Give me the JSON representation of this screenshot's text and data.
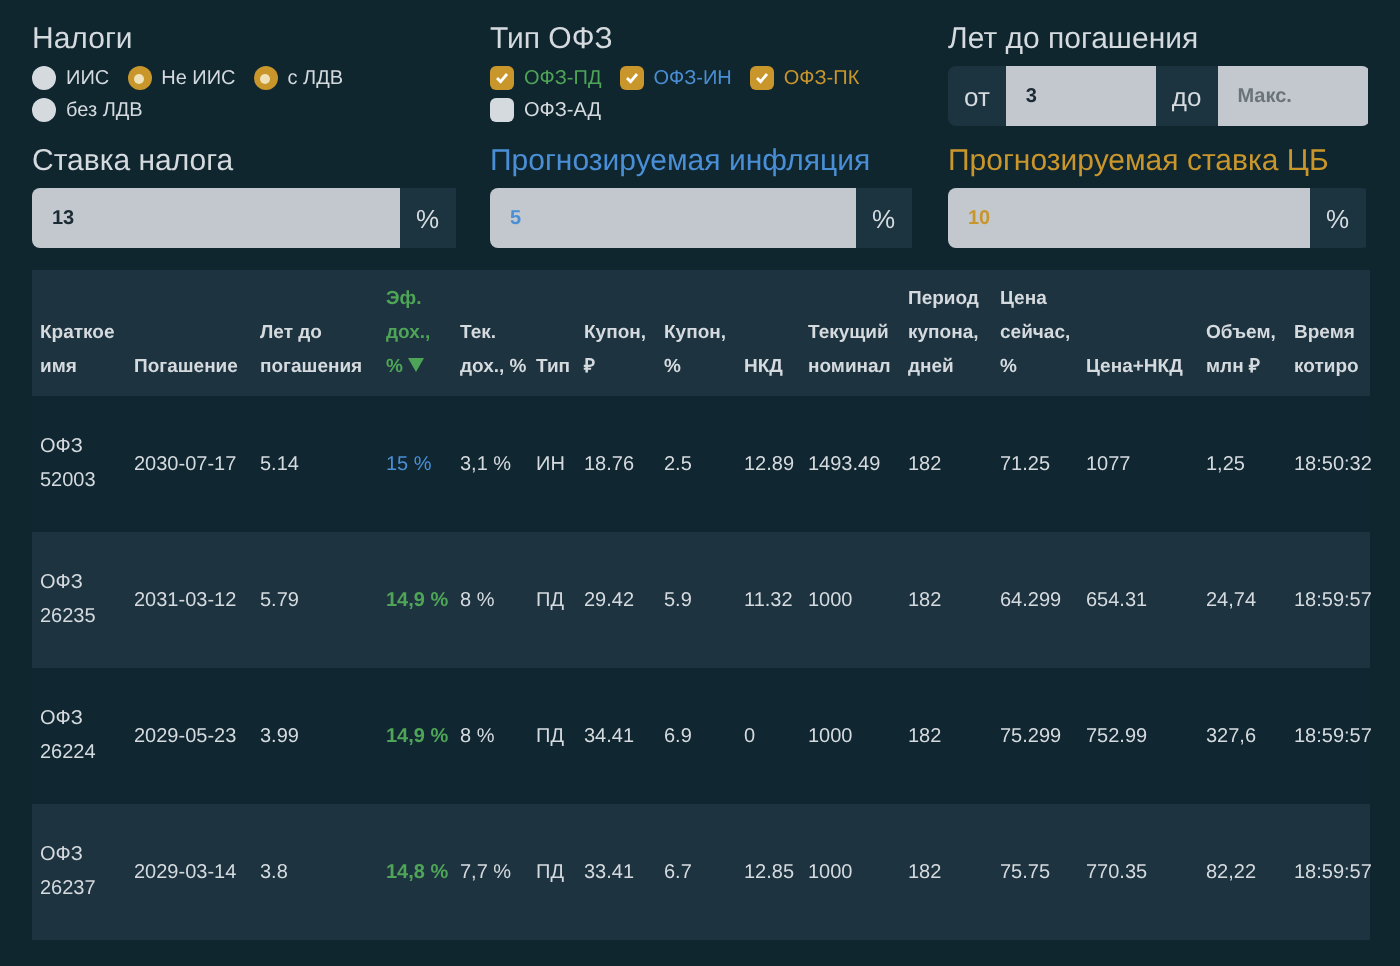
{
  "taxes": {
    "title": "Налоги",
    "options": [
      {
        "label": "ИИС",
        "checked": false
      },
      {
        "label": "Не ИИС",
        "checked": true
      },
      {
        "label": "с ЛДВ",
        "checked": true
      },
      {
        "label": "без ЛДВ",
        "checked": false
      }
    ]
  },
  "bond_types": {
    "title": "Тип ОФЗ",
    "options": [
      {
        "label": "ОФЗ-ПД",
        "checked": true,
        "color": "#4fa557"
      },
      {
        "label": "ОФЗ-ИН",
        "checked": true,
        "color": "#4a8fd6"
      },
      {
        "label": "ОФЗ-ПК",
        "checked": true,
        "color": "#c9962c"
      },
      {
        "label": "ОФЗ-АД",
        "checked": false,
        "color": "#d5dadf"
      }
    ]
  },
  "years_to_maturity": {
    "title": "Лет до погашения",
    "from_label": "от",
    "from_value": "3",
    "to_label": "до",
    "to_placeholder": "Макс."
  },
  "rates": [
    {
      "title": "Ставка налога",
      "value": "13",
      "unit": "%"
    },
    {
      "title": "Прогнозируемая инфляция",
      "value": "5",
      "unit": "%",
      "color": "#4a8fd6"
    },
    {
      "title": "Прогнозируемая ставка ЦБ",
      "value": "10",
      "unit": "%",
      "color": "#c9962c"
    }
  ],
  "table": {
    "columns": [
      {
        "label": "Краткое имя",
        "sorted": false
      },
      {
        "label": "Погашение",
        "sorted": false
      },
      {
        "label": "Лет до погашения",
        "sorted": false
      },
      {
        "label": "Эф. дох., %",
        "sorted": true
      },
      {
        "label": "Тек. дох., %",
        "sorted": false
      },
      {
        "label": "Тип",
        "sorted": false
      },
      {
        "label": "Купон, ₽",
        "sorted": false
      },
      {
        "label": "Купон, %",
        "sorted": false
      },
      {
        "label": "НКД",
        "sorted": false
      },
      {
        "label": "Текущий номинал",
        "sorted": false
      },
      {
        "label": "Период купона, дней",
        "sorted": false
      },
      {
        "label": "Цена сейчас, %",
        "sorted": false
      },
      {
        "label": "Цена+НКД",
        "sorted": false
      },
      {
        "label": "Объем, млн ₽",
        "sorted": false
      },
      {
        "label": "Время котиро",
        "sorted": false
      }
    ],
    "rows": [
      {
        "color": "#4a8fd6",
        "cells": [
          "ОФЗ 52003",
          "2030-07-17",
          "5.14",
          "15 %",
          "3,1 %",
          "ИН",
          "18.76",
          "2.5",
          "12.89",
          "1493.49",
          "182",
          "71.25",
          "1077",
          "1,25",
          "18:50:32"
        ]
      },
      {
        "color": "#4fa557",
        "cells": [
          "ОФЗ 26235",
          "2031-03-12",
          "5.79",
          "14,9 %",
          "8 %",
          "ПД",
          "29.42",
          "5.9",
          "11.32",
          "1000",
          "182",
          "64.299",
          "654.31",
          "24,74",
          "18:59:57"
        ]
      },
      {
        "color": "#4fa557",
        "cells": [
          "ОФЗ 26224",
          "2029-05-23",
          "3.99",
          "14,9 %",
          "8 %",
          "ПД",
          "34.41",
          "6.9",
          "0",
          "1000",
          "182",
          "75.299",
          "752.99",
          "327,6",
          "18:59:57"
        ]
      },
      {
        "color": "#4fa557",
        "cells": [
          "ОФЗ 26237",
          "2029-03-14",
          "3.8",
          "14,8 %",
          "7,7 %",
          "ПД",
          "33.41",
          "6.7",
          "12.85",
          "1000",
          "182",
          "75.75",
          "770.35",
          "82,22",
          "18:59:57"
        ]
      }
    ]
  }
}
